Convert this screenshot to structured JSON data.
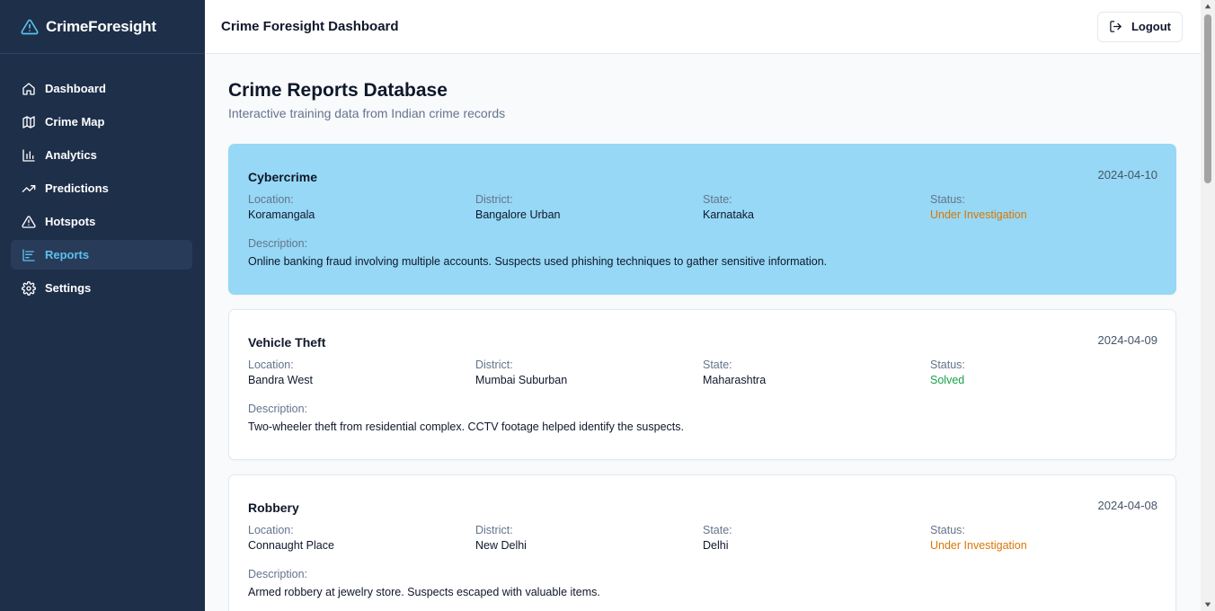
{
  "app": {
    "brand": "CrimeForesight",
    "header_title": "Crime Foresight Dashboard",
    "logout_label": "Logout"
  },
  "sidebar": {
    "items": [
      {
        "label": "Dashboard",
        "icon": "home-icon"
      },
      {
        "label": "Crime Map",
        "icon": "map-icon"
      },
      {
        "label": "Analytics",
        "icon": "bar-chart-icon"
      },
      {
        "label": "Predictions",
        "icon": "trending-up-icon"
      },
      {
        "label": "Hotspots",
        "icon": "alert-triangle-icon"
      },
      {
        "label": "Reports",
        "icon": "reports-chart-icon",
        "active": true
      },
      {
        "label": "Settings",
        "icon": "gear-icon"
      }
    ]
  },
  "page": {
    "title": "Crime Reports Database",
    "subtitle": "Interactive training data from Indian crime records"
  },
  "labels": {
    "location": "Location:",
    "district": "District:",
    "state": "State:",
    "status": "Status:",
    "description": "Description:"
  },
  "reports": [
    {
      "type": "Cybercrime",
      "date": "2024-04-10",
      "location": "Koramangala",
      "district": "Bangalore Urban",
      "state": "Karnataka",
      "status": "Under Investigation",
      "description": "Online banking fraud involving multiple accounts. Suspects used phishing techniques to gather sensitive information."
    },
    {
      "type": "Vehicle Theft",
      "date": "2024-04-09",
      "location": "Bandra West",
      "district": "Mumbai Suburban",
      "state": "Maharashtra",
      "status": "Solved",
      "description": "Two-wheeler theft from residential complex. CCTV footage helped identify the suspects."
    },
    {
      "type": "Robbery",
      "date": "2024-04-08",
      "location": "Connaught Place",
      "district": "New Delhi",
      "state": "Delhi",
      "status": "Under Investigation",
      "description": "Armed robbery at jewelry store. Suspects escaped with valuable items."
    }
  ],
  "colors": {
    "sidebar_bg": "#1e2f4a",
    "active_nav": "#5bc0f0",
    "highlight_card": "#96d8f5",
    "status_under_investigation": "#d97706",
    "status_solved": "#16a34a"
  }
}
